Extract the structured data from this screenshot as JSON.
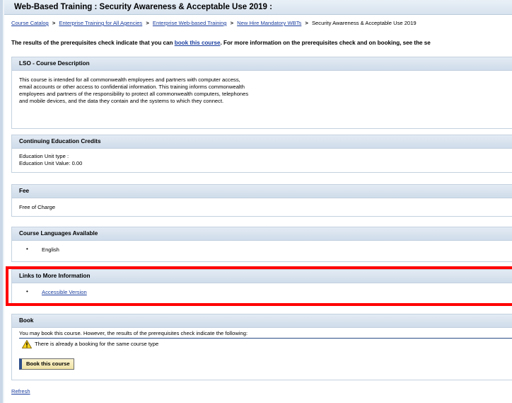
{
  "title": "Web-Based Training : Security Awareness & Acceptable Use 2019 :",
  "breadcrumb": {
    "links": [
      "Course Catalog",
      "Enterprise Training for All Agencies",
      "Enterprise Web-based Training",
      "New Hire Mandatory WBTs"
    ],
    "separator": ">",
    "current": "Security Awareness & Acceptable Use 2019"
  },
  "notice": {
    "before": "The results of the prerequisites check indicate that you can ",
    "link": "book this course",
    "after": ". For more information on the prerequisites check and on booking, see the se"
  },
  "description": {
    "header": "LSO - Course Description",
    "text": "This course is intended for all commonwealth employees and partners with computer access, email accounts or other access to confidential information. This training informs commonwealth employees and partners of the responsibility to protect all commonwealth computers, telephones and mobile devices, and the data they contain and the systems to which they connect."
  },
  "credits": {
    "header": "Continuing Education Credits",
    "unit_type_label": "Education Unit type  :",
    "unit_value_label": "Education Unit Value:  0.00"
  },
  "fee": {
    "header": "Fee",
    "value": "Free of Charge"
  },
  "languages": {
    "header": "Course Languages Available",
    "items": [
      "English"
    ]
  },
  "links": {
    "header": "Links to More Information",
    "items": [
      "Accessible Version"
    ]
  },
  "book": {
    "header": "Book",
    "message": "You may book this course. However, the results of the prerequisites check indicate the following:",
    "warning": "There is already a booking for the same course type",
    "button": "Book this course"
  },
  "refresh": "Refresh",
  "colors": {
    "highlight": "#ff0000",
    "link": "#1a3d9e",
    "header_bg": "#d7e3ef"
  }
}
